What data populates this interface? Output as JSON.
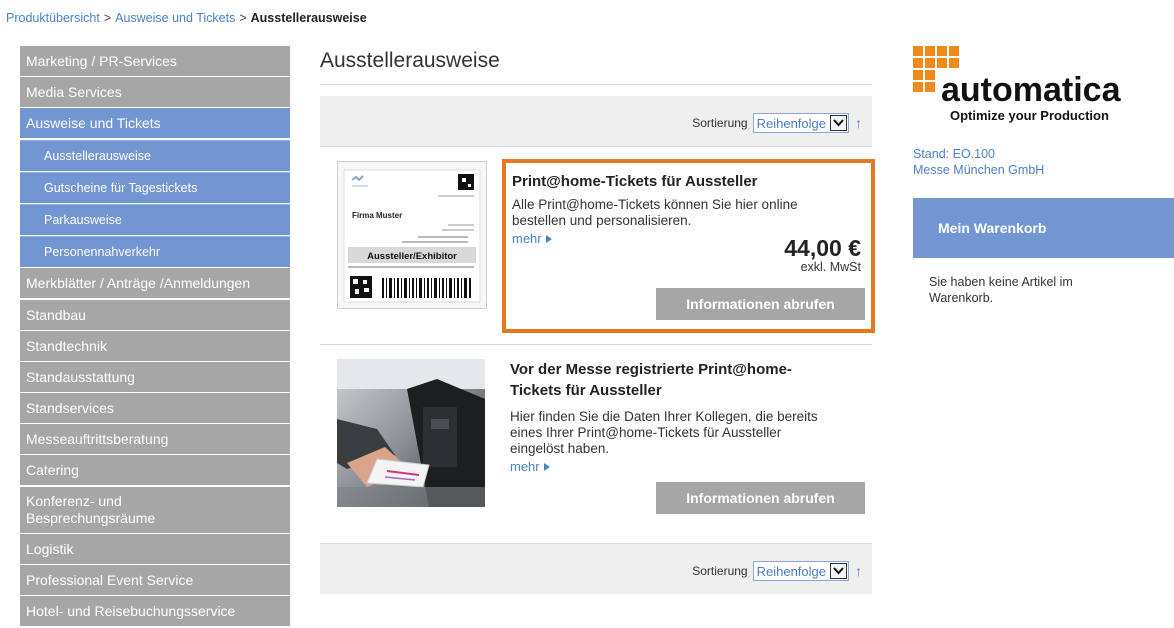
{
  "breadcrumb": {
    "items": [
      "Produktübersicht",
      "Ausweise und Tickets"
    ],
    "current": "Ausstellerausweise",
    "separator": ">"
  },
  "sidebar": {
    "items": [
      {
        "label": "Marketing / PR-Services"
      },
      {
        "label": "Media Services"
      },
      {
        "label": "Ausweise und Tickets"
      },
      {
        "label": "Ausstellerausweise"
      },
      {
        "label": "Gutscheine für Tagestickets"
      },
      {
        "label": "Parkausweise"
      },
      {
        "label": "Personennahverkehr"
      },
      {
        "label": "Merkblätter / Anträge /Anmeldungen"
      },
      {
        "label": "Standbau"
      },
      {
        "label": "Standtechnik"
      },
      {
        "label": "Standausstattung"
      },
      {
        "label": "Standservices"
      },
      {
        "label": "Messeauftrittsberatung"
      },
      {
        "label": "Catering"
      },
      {
        "label": "Konferenz- und Besprechungsräume",
        "line1": "Konferenz- und",
        "line2": "Besprechungsräume"
      },
      {
        "label": "Logistik"
      },
      {
        "label": "Professional Event Service"
      },
      {
        "label": "Hotel- und Reisebuchungsservice"
      }
    ]
  },
  "main": {
    "title": "Ausstellerausweise",
    "sort": {
      "label": "Sortierung",
      "selected": "Reihenfolge"
    },
    "products": [
      {
        "title": "Print@home-Tickets für Aussteller",
        "desc_line1": "Alle Print@home-Tickets können Sie hier online",
        "desc_line2": "bestellen und personalisieren.",
        "more": "mehr",
        "price": "44,00 €",
        "tax": "exkl. MwSt",
        "button": "Informationen abrufen",
        "ticket": {
          "company": "Firma Muster",
          "badge": "Aussteller/Exhibitor"
        }
      },
      {
        "title_line1": "Vor der Messe registrierte Print@home-",
        "title_line2": "Tickets für Aussteller",
        "desc_line1": "Hier finden Sie die Daten Ihrer Kollegen, die bereits",
        "desc_line2": "eines Ihrer Print@home-Tickets für Aussteller",
        "desc_line3": "eingelöst haben.",
        "more": "mehr",
        "button": "Informationen abrufen"
      }
    ]
  },
  "right": {
    "logo_word": "automatica",
    "logo_tagline": "Optimize your Production",
    "stand": "Stand: EO.100",
    "company": "Messe München GmbH",
    "cart_title": "Mein Warenkorb",
    "cart_text": "Sie haben keine Artikel im Warenkorb."
  },
  "colors": {
    "nav_grey": "#a6a6a6",
    "nav_blue": "#7196d2",
    "link_blue": "#4a82c8",
    "highlight_orange": "#e87722",
    "logo_orange": "#f08a1c"
  }
}
